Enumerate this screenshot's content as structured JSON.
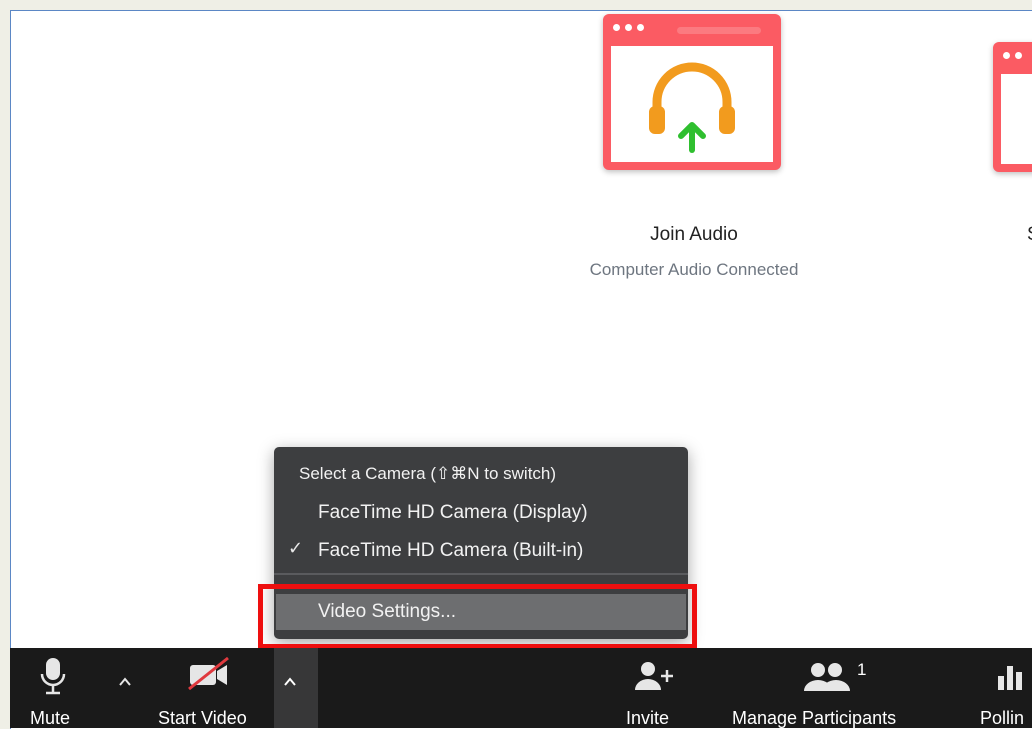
{
  "join_audio": {
    "title": "Join Audio",
    "subtitle": "Computer Audio Connected"
  },
  "edge_text": "S",
  "camera_menu": {
    "header": "Select a Camera (⇧⌘N to switch)",
    "options": [
      {
        "label": "FaceTime HD Camera (Display)",
        "checked": false
      },
      {
        "label": "FaceTime HD Camera (Built-in)",
        "checked": true
      }
    ],
    "check_glyph": "✓",
    "settings_label": "Video Settings..."
  },
  "toolbar": {
    "mute_label": "Mute",
    "start_video_label": "Start Video",
    "invite_label": "Invite",
    "manage_participants_label": "Manage Participants",
    "participant_count": "1",
    "polling_label": "Pollin"
  },
  "colors": {
    "card_red": "#fb5b63",
    "headphone_orange": "#f29b1e",
    "arrow_green": "#2fbf2f",
    "video_off_red": "#e0393e",
    "highlight_red": "#ee0f0f",
    "menu_bg": "#3d3e40",
    "toolbar_bg": "#1a1a1a"
  },
  "icons": [
    "headphones-icon",
    "up-arrow-icon",
    "microphone-icon",
    "video-off-icon",
    "chevron-up-icon",
    "add-person-icon",
    "participants-icon",
    "polling-icon",
    "checkmark-icon"
  ]
}
